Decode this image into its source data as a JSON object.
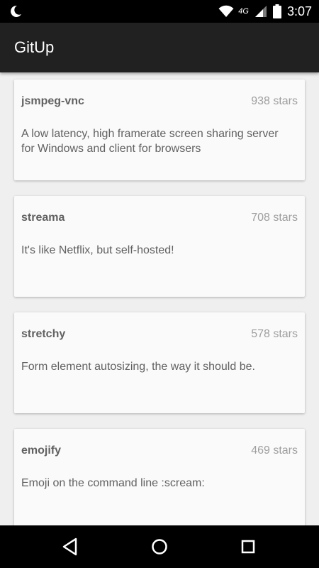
{
  "status_bar": {
    "time": "3:07",
    "network": "4G",
    "icons": [
      "do-not-disturb-moon-icon",
      "wifi-icon",
      "cellular-signal-icon",
      "battery-icon"
    ]
  },
  "app_bar": {
    "title": "GitUp"
  },
  "repos": [
    {
      "name": "jsmpeg-vnc",
      "stars": "938 stars",
      "description": "A low latency, high framerate screen sharing server for Windows and client for browsers"
    },
    {
      "name": "streama",
      "stars": "708 stars",
      "description": "It's like Netflix, but self-hosted!"
    },
    {
      "name": "stretchy",
      "stars": "578 stars",
      "description": "Form element autosizing, the way it should be."
    },
    {
      "name": "emojify",
      "stars": "469 stars",
      "description": "Emoji on the command line :scream:"
    }
  ],
  "nav_bar": {
    "icons": [
      "back-icon",
      "home-icon",
      "recents-icon"
    ]
  }
}
